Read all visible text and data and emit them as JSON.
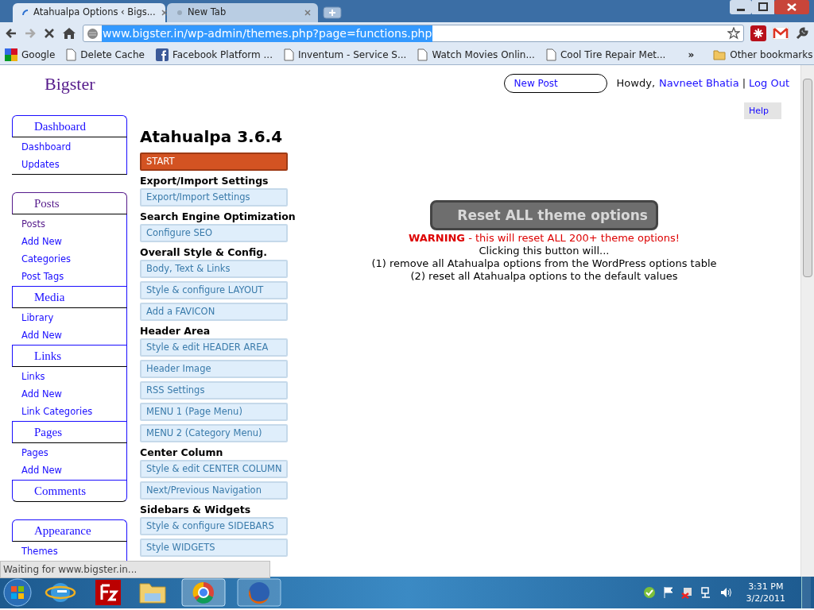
{
  "browser": {
    "tabs": [
      {
        "title": "Atahualpa Options ‹ Bigs...",
        "selected": true,
        "loading": true
      },
      {
        "title": "New Tab",
        "selected": false,
        "loading": false
      }
    ],
    "address": "www.bigster.in/wp-admin/themes.php?page=functions.php",
    "bookmarks": [
      {
        "label": "Google",
        "kind": "google"
      },
      {
        "label": "Delete Cache",
        "kind": "page"
      },
      {
        "label": "Facebook Platform ...",
        "kind": "facebook"
      },
      {
        "label": "Inventum - Service S...",
        "kind": "page"
      },
      {
        "label": "Watch Movies Onlin...",
        "kind": "page"
      },
      {
        "label": "Cool Tire Repair Met...",
        "kind": "page"
      }
    ],
    "more": "»",
    "other_bookmarks": "Other bookmarks"
  },
  "page": {
    "site_title": "Bigster",
    "new_post": "New Post",
    "greeting": "Howdy,",
    "user": "Navneet Bhatia",
    "separator": "|",
    "logout": "Log Out",
    "help": "Help"
  },
  "sidebar": {
    "groups": [
      [
        {
          "heading": "Dashboard",
          "selected": false,
          "items": [
            {
              "label": "Dashboard",
              "selected": false
            },
            {
              "label": "Updates",
              "selected": false
            }
          ]
        }
      ],
      [
        {
          "heading": "Posts",
          "selected": true,
          "items": [
            {
              "label": "Posts",
              "selected": true
            },
            {
              "label": "Add New",
              "selected": false
            },
            {
              "label": "Categories",
              "selected": false
            },
            {
              "label": "Post Tags",
              "selected": false
            }
          ]
        },
        {
          "heading": "Media",
          "selected": false,
          "items": [
            {
              "label": "Library",
              "selected": false
            },
            {
              "label": "Add New",
              "selected": false
            }
          ]
        },
        {
          "heading": "Links",
          "selected": false,
          "items": [
            {
              "label": "Links",
              "selected": false
            },
            {
              "label": "Add New",
              "selected": false
            },
            {
              "label": "Link Categories",
              "selected": false
            }
          ]
        },
        {
          "heading": "Pages",
          "selected": false,
          "items": [
            {
              "label": "Pages",
              "selected": false
            },
            {
              "label": "Add New",
              "selected": false
            }
          ]
        },
        {
          "heading": "Comments",
          "selected": false
        }
      ],
      [
        {
          "heading": "Appearance",
          "selected": false,
          "items": [
            {
              "label": "Themes",
              "selected": false
            }
          ]
        }
      ]
    ]
  },
  "theme_menu": {
    "title": "Atahualpa 3.6.4",
    "entries": [
      {
        "kind": "button",
        "label": "START",
        "selected": true
      },
      {
        "kind": "heading",
        "label": "Export/Import Settings"
      },
      {
        "kind": "button",
        "label": "Export/Import Settings",
        "selected": false
      },
      {
        "kind": "heading",
        "label": "Search Engine Optimization"
      },
      {
        "kind": "button",
        "label": "Configure SEO",
        "selected": false
      },
      {
        "kind": "heading",
        "label": "Overall Style & Config."
      },
      {
        "kind": "button",
        "label": "Body, Text & Links",
        "selected": false
      },
      {
        "kind": "button",
        "label": "Style & configure LAYOUT",
        "selected": false
      },
      {
        "kind": "button",
        "label": "Add a FAVICON",
        "selected": false
      },
      {
        "kind": "heading",
        "label": "Header Area"
      },
      {
        "kind": "button",
        "label": "Style & edit HEADER AREA",
        "selected": false
      },
      {
        "kind": "button",
        "label": "Header Image",
        "selected": false
      },
      {
        "kind": "button",
        "label": "RSS Settings",
        "selected": false
      },
      {
        "kind": "button",
        "label": "MENU 1 (Page Menu)",
        "selected": false
      },
      {
        "kind": "button",
        "label": "MENU 2 (Category Menu)",
        "selected": false
      },
      {
        "kind": "heading",
        "label": "Center Column"
      },
      {
        "kind": "button",
        "label": "Style & edit CENTER COLUMN",
        "selected": false
      },
      {
        "kind": "button",
        "label": "Next/Previous Navigation",
        "selected": false
      },
      {
        "kind": "heading",
        "label": "Sidebars & Widgets"
      },
      {
        "kind": "button",
        "label": "Style & configure SIDEBARS",
        "selected": false
      },
      {
        "kind": "button",
        "label": "Style WIDGETS",
        "selected": false
      }
    ]
  },
  "reset": {
    "button": "Reset ALL theme options",
    "warning": "**WARNING** - this will reset ALL 200+ theme options!",
    "lines": [
      "Clicking this button will...",
      "(1) remove all Atahualpa options from the WordPress options table",
      "(2) reset all Atahualpa options to the default values"
    ]
  },
  "status_bar": "Waiting for www.bigster.in...",
  "taskbar": {
    "time": "3:31 PM",
    "date": "3/2/2011"
  }
}
